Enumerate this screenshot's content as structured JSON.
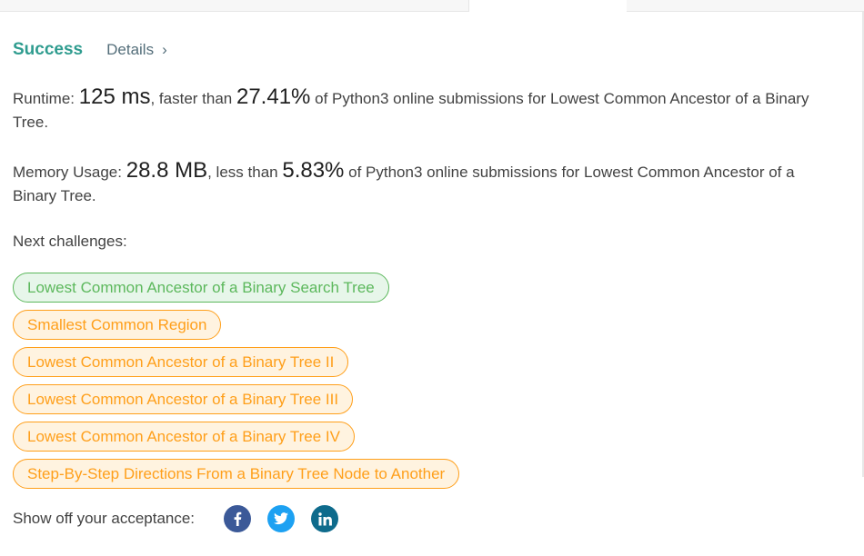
{
  "status": {
    "result": "Success",
    "details_label": "Details",
    "details_chevron": "›"
  },
  "runtime": {
    "label": "Runtime:",
    "value": "125 ms",
    "comparison": ", faster than",
    "percent": "27.41%",
    "suffix": "of Python3 online submissions for Lowest Common Ancestor of a Binary Tree."
  },
  "memory": {
    "label": "Memory Usage:",
    "value": "28.8 MB",
    "comparison": ", less than",
    "percent": "5.83%",
    "suffix": "of Python3 online submissions for Lowest Common Ancestor of a Binary Tree."
  },
  "next_challenges": {
    "label": "Next challenges:",
    "items": [
      {
        "label": "Lowest Common Ancestor of a Binary Search Tree",
        "difficulty": "easy"
      },
      {
        "label": "Smallest Common Region",
        "difficulty": "medium"
      },
      {
        "label": "Lowest Common Ancestor of a Binary Tree II",
        "difficulty": "medium"
      },
      {
        "label": "Lowest Common Ancestor of a Binary Tree III",
        "difficulty": "medium"
      },
      {
        "label": "Lowest Common Ancestor of a Binary Tree IV",
        "difficulty": "medium"
      },
      {
        "label": "Step-By-Step Directions From a Binary Tree Node to Another",
        "difficulty": "medium"
      }
    ]
  },
  "share": {
    "label": "Show off your acceptance:",
    "icons": [
      "facebook-icon",
      "twitter-icon",
      "linkedin-icon"
    ]
  },
  "colors": {
    "success": "#2f9c8f",
    "easy": "#5cb85c",
    "medium": "#ff9f1a",
    "facebook": "#3b5998",
    "twitter": "#1da1f2",
    "linkedin": "#0e6b8c"
  }
}
